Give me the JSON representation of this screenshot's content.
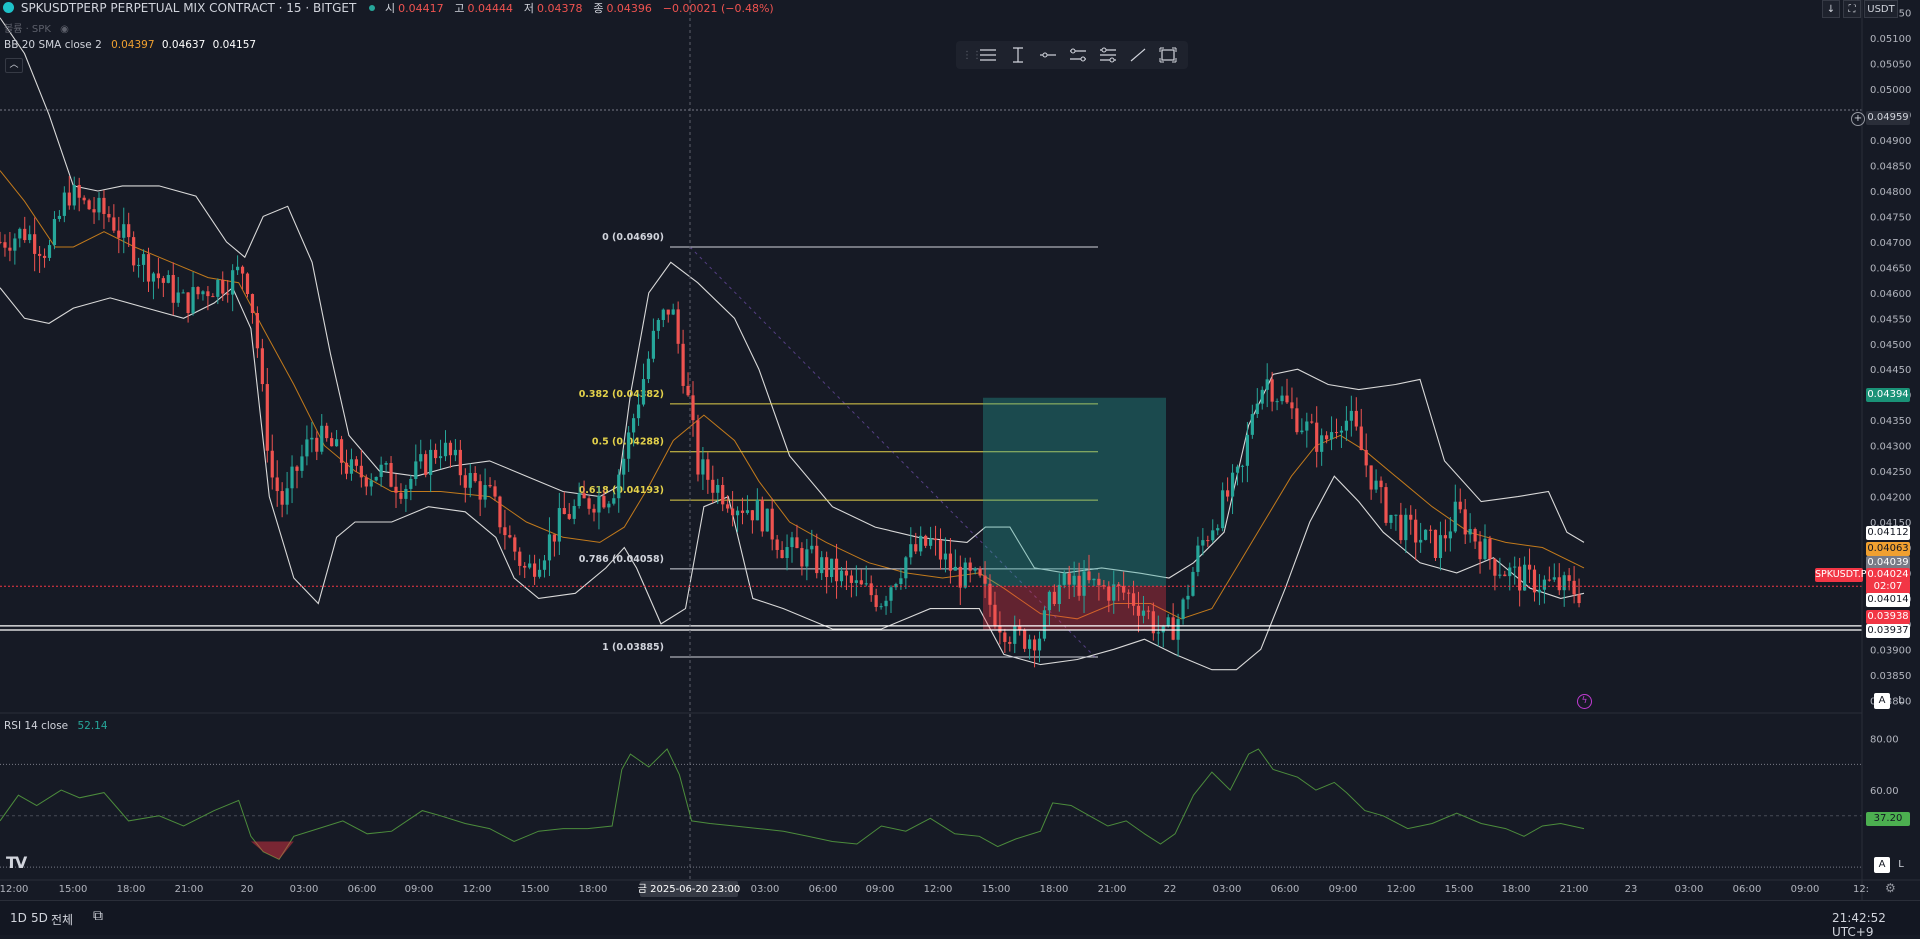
{
  "header": {
    "symbol": "SPKUSDTPERP PERPETUAL MIX CONTRACT · 15 · BITGET",
    "o_label": "시",
    "o_val": "0.04417",
    "h_label": "고",
    "h_val": "0.04444",
    "l_label": "저",
    "l_val": "0.04378",
    "c_label": "종",
    "c_val": "0.04396",
    "change": "−0.00021 (−0.48%)",
    "sub_label": "볼륨 · SPK"
  },
  "indicators": {
    "bb_label": "BB 20 SMA close 2",
    "bb_basis": "0.04397",
    "bb_upper": "0.04637",
    "bb_lower": "0.04157",
    "rsi_label": "RSI 14 close",
    "rsi_value": "52.14"
  },
  "top_right": {
    "currency": "USDT",
    "download_icon": "download-icon",
    "fullscreen_icon": "fullscreen-icon"
  },
  "drawing_toolbar": {
    "icons": [
      "horizontal-lines-icon",
      "vertical-line-icon",
      "horizontal-ray-icon",
      "parallel-lines-icon",
      "fib-lines-icon",
      "trend-line-icon",
      "rectangle-icon"
    ]
  },
  "price_axis": {
    "ticks": [
      "0.05150",
      "0.05100",
      "0.05050",
      "0.05000",
      "0.04950",
      "0.04900",
      "0.04850",
      "0.04800",
      "0.04750",
      "0.04700",
      "0.04650",
      "0.04600",
      "0.04550",
      "0.04500",
      "0.04450",
      "0.04400",
      "0.04350",
      "0.04300",
      "0.04250",
      "0.04200",
      "0.04150",
      "0.04100",
      "0.04050",
      "0.04000",
      "0.03950",
      "0.03900",
      "0.03850",
      "0.03800"
    ],
    "labels": {
      "alert": "0.04959",
      "green": "0.04394",
      "white1": "0.04112",
      "orange": "0.04063",
      "gray": "0.04039",
      "current": "0.04024",
      "countdown": "02:07",
      "white2": "0.04014",
      "red": "0.03938",
      "white3": "0.03937",
      "symbol_tag": "SPKUSDT.P"
    }
  },
  "rsi_axis": {
    "ticks": [
      "80.00",
      "60.00"
    ],
    "current": "37.20"
  },
  "fib_levels": [
    {
      "ratio_label": "0 (0.04690)",
      "price": 0.0469,
      "color": "#d1d4dc"
    },
    {
      "ratio_label": "0.382 (0.04382)",
      "price": 0.04382,
      "color": "#e3d14a"
    },
    {
      "ratio_label": "0.5 (0.04288)",
      "price": 0.04288,
      "color": "#e3d14a"
    },
    {
      "ratio_label": "0.618 (0.04193)",
      "price": 0.04193,
      "color": "#e3d14a"
    },
    {
      "ratio_label": "0.786 (0.04058)",
      "price": 0.04058,
      "color": "#d1d4dc"
    },
    {
      "ratio_label": "1 (0.03885)",
      "price": 0.03885,
      "color": "#d1d4dc"
    }
  ],
  "time_axis": {
    "ticks": [
      "12:00",
      "15:00",
      "18:00",
      "21:00",
      "20",
      "03:00",
      "06:00",
      "09:00",
      "12:00",
      "15:00",
      "18:00",
      "2025-06-20  23:00",
      "03:00",
      "06:00",
      "09:00",
      "12:00",
      "15:00",
      "18:00",
      "21:00",
      "22",
      "03:00",
      "06:00",
      "09:00",
      "12:00",
      "15:00",
      "18:00",
      "21:00",
      "23",
      "03:00",
      "06:00",
      "09:00",
      "12:"
    ],
    "crosshair_label": "금 2025-06-20  23:00"
  },
  "bottom_bar": {
    "range_1d": "1D",
    "range_5d": "5D",
    "range_all": "전체",
    "calendar_icon": "calendar-range-icon",
    "clock": "21:42:52 UTC+9"
  },
  "buttons": {
    "auto": "A",
    "log": "L"
  },
  "colors": {
    "bg": "#161a25",
    "up": "#26a69a",
    "down": "#ef5350",
    "bb": "#d9d9d9",
    "basis": "#c27a1c",
    "rsi": "#4c8c3c",
    "fib_gold": "#e3d14a"
  },
  "chart_data": {
    "type": "candlestick",
    "title": "SPKUSDTPERP PERPETUAL MIX CONTRACT · 15 · BITGET",
    "ylim": [
      0.03775,
      0.05175
    ],
    "y_ticks": [
      0.0515,
      0.051,
      0.0505,
      0.05,
      0.0495,
      0.049,
      0.0485,
      0.048,
      0.0475,
      0.047,
      0.0465,
      0.046,
      0.0455,
      0.045,
      0.0445,
      0.044,
      0.0435,
      0.043,
      0.0425,
      0.042,
      0.0415,
      0.041,
      0.0405,
      0.04,
      0.0395,
      0.039,
      0.0385,
      0.038
    ],
    "close_path": [
      [
        0,
        0.047
      ],
      [
        20,
        0.0472
      ],
      [
        40,
        0.0468
      ],
      [
        55,
        0.048
      ],
      [
        70,
        0.0477
      ],
      [
        90,
        0.0475
      ],
      [
        100,
        0.0471
      ],
      [
        110,
        0.0468
      ],
      [
        130,
        0.0463
      ],
      [
        150,
        0.0458
      ],
      [
        170,
        0.0461
      ],
      [
        190,
        0.0463
      ],
      [
        200,
        0.0465
      ],
      [
        208,
        0.0455
      ],
      [
        215,
        0.0438
      ],
      [
        222,
        0.0424
      ],
      [
        232,
        0.0418
      ],
      [
        240,
        0.0424
      ],
      [
        255,
        0.0432
      ],
      [
        270,
        0.043
      ],
      [
        290,
        0.0424
      ],
      [
        310,
        0.0425
      ],
      [
        330,
        0.0422
      ],
      [
        345,
        0.0426
      ],
      [
        360,
        0.043
      ],
      [
        380,
        0.0424
      ],
      [
        400,
        0.042
      ],
      [
        415,
        0.0412
      ],
      [
        430,
        0.0405
      ],
      [
        445,
        0.041
      ],
      [
        460,
        0.0416
      ],
      [
        480,
        0.0419
      ],
      [
        500,
        0.0421
      ],
      [
        510,
        0.0428
      ],
      [
        520,
        0.0438
      ],
      [
        535,
        0.0452
      ],
      [
        548,
        0.0458
      ],
      [
        560,
        0.0442
      ],
      [
        570,
        0.0426
      ],
      [
        585,
        0.0422
      ],
      [
        600,
        0.0419
      ],
      [
        620,
        0.0417
      ],
      [
        640,
        0.041
      ],
      [
        660,
        0.0408
      ],
      [
        680,
        0.0405
      ],
      [
        700,
        0.0402
      ],
      [
        720,
        0.04
      ],
      [
        740,
        0.0408
      ],
      [
        760,
        0.0411
      ],
      [
        780,
        0.0405
      ],
      [
        800,
        0.0403
      ],
      [
        815,
        0.0396
      ],
      [
        830,
        0.0392
      ],
      [
        850,
        0.0393
      ],
      [
        862,
        0.0402
      ],
      [
        880,
        0.0403
      ],
      [
        900,
        0.0402
      ],
      [
        920,
        0.0401
      ],
      [
        935,
        0.0398
      ],
      [
        950,
        0.0392
      ],
      [
        965,
        0.0397
      ],
      [
        980,
        0.041
      ],
      [
        1000,
        0.0419
      ],
      [
        1015,
        0.0425
      ],
      [
        1025,
        0.044
      ],
      [
        1035,
        0.0443
      ],
      [
        1050,
        0.0438
      ],
      [
        1065,
        0.0434
      ],
      [
        1080,
        0.043
      ],
      [
        1095,
        0.0436
      ],
      [
        1105,
        0.0434
      ],
      [
        1115,
        0.0427
      ],
      [
        1130,
        0.0418
      ],
      [
        1145,
        0.0414
      ],
      [
        1160,
        0.0412
      ],
      [
        1175,
        0.041
      ],
      [
        1190,
        0.0417
      ],
      [
        1205,
        0.0412
      ],
      [
        1220,
        0.0407
      ],
      [
        1240,
        0.0404
      ],
      [
        1260,
        0.0403
      ],
      [
        1280,
        0.0402
      ],
      [
        1294,
        0.0401
      ]
    ],
    "bb_upper_path": [
      [
        0,
        0.0514
      ],
      [
        20,
        0.0507
      ],
      [
        40,
        0.0495
      ],
      [
        60,
        0.0481
      ],
      [
        80,
        0.048
      ],
      [
        100,
        0.0481
      ],
      [
        130,
        0.0481
      ],
      [
        160,
        0.0479
      ],
      [
        185,
        0.047
      ],
      [
        200,
        0.0467
      ],
      [
        215,
        0.0475
      ],
      [
        235,
        0.0477
      ],
      [
        255,
        0.0466
      ],
      [
        270,
        0.0448
      ],
      [
        285,
        0.0432
      ],
      [
        310,
        0.0425
      ],
      [
        340,
        0.0424
      ],
      [
        370,
        0.0426
      ],
      [
        400,
        0.0427
      ],
      [
        430,
        0.0424
      ],
      [
        460,
        0.0421
      ],
      [
        490,
        0.042
      ],
      [
        505,
        0.0422
      ],
      [
        515,
        0.044
      ],
      [
        530,
        0.046
      ],
      [
        548,
        0.0466
      ],
      [
        570,
        0.0462
      ],
      [
        600,
        0.0455
      ],
      [
        620,
        0.0445
      ],
      [
        645,
        0.0428
      ],
      [
        680,
        0.0418
      ],
      [
        715,
        0.0414
      ],
      [
        750,
        0.0412
      ],
      [
        790,
        0.0411
      ],
      [
        805,
        0.0414
      ],
      [
        825,
        0.0414
      ],
      [
        845,
        0.0406
      ],
      [
        870,
        0.0405
      ],
      [
        900,
        0.0406
      ],
      [
        930,
        0.0405
      ],
      [
        955,
        0.0404
      ],
      [
        975,
        0.0407
      ],
      [
        1000,
        0.0413
      ],
      [
        1020,
        0.0434
      ],
      [
        1040,
        0.0444
      ],
      [
        1060,
        0.0445
      ],
      [
        1085,
        0.0442
      ],
      [
        1110,
        0.0441
      ],
      [
        1140,
        0.0442
      ],
      [
        1160,
        0.0443
      ],
      [
        1180,
        0.0427
      ],
      [
        1210,
        0.0419
      ],
      [
        1240,
        0.042
      ],
      [
        1265,
        0.0421
      ],
      [
        1280,
        0.0413
      ],
      [
        1294,
        0.0411
      ]
    ],
    "bb_lower_path": [
      [
        0,
        0.0461
      ],
      [
        20,
        0.0455
      ],
      [
        40,
        0.0454
      ],
      [
        60,
        0.0457
      ],
      [
        90,
        0.0459
      ],
      [
        120,
        0.0457
      ],
      [
        150,
        0.0455
      ],
      [
        175,
        0.0458
      ],
      [
        190,
        0.0461
      ],
      [
        205,
        0.0453
      ],
      [
        220,
        0.042
      ],
      [
        240,
        0.0404
      ],
      [
        260,
        0.0399
      ],
      [
        275,
        0.0412
      ],
      [
        290,
        0.0415
      ],
      [
        320,
        0.0415
      ],
      [
        350,
        0.0418
      ],
      [
        380,
        0.0417
      ],
      [
        405,
        0.0412
      ],
      [
        420,
        0.0404
      ],
      [
        440,
        0.04
      ],
      [
        470,
        0.0401
      ],
      [
        495,
        0.0406
      ],
      [
        510,
        0.041
      ],
      [
        520,
        0.0406
      ],
      [
        540,
        0.0395
      ],
      [
        560,
        0.0398
      ],
      [
        575,
        0.0418
      ],
      [
        595,
        0.042
      ],
      [
        615,
        0.04
      ],
      [
        640,
        0.0398
      ],
      [
        680,
        0.0394
      ],
      [
        720,
        0.0394
      ],
      [
        760,
        0.0398
      ],
      [
        800,
        0.0398
      ],
      [
        820,
        0.0389
      ],
      [
        850,
        0.0387
      ],
      [
        880,
        0.0388
      ],
      [
        910,
        0.039
      ],
      [
        935,
        0.0392
      ],
      [
        960,
        0.0389
      ],
      [
        990,
        0.0386
      ],
      [
        1010,
        0.0386
      ],
      [
        1030,
        0.039
      ],
      [
        1050,
        0.0402
      ],
      [
        1070,
        0.0415
      ],
      [
        1090,
        0.0424
      ],
      [
        1110,
        0.0419
      ],
      [
        1130,
        0.0413
      ],
      [
        1160,
        0.0407
      ],
      [
        1190,
        0.0405
      ],
      [
        1220,
        0.0408
      ],
      [
        1250,
        0.0402
      ],
      [
        1275,
        0.04
      ],
      [
        1294,
        0.0401
      ]
    ],
    "bb_basis_path": [
      [
        0,
        0.0484
      ],
      [
        20,
        0.0478
      ],
      [
        45,
        0.0469
      ],
      [
        60,
        0.0469
      ],
      [
        85,
        0.0472
      ],
      [
        110,
        0.0469
      ],
      [
        140,
        0.0466
      ],
      [
        170,
        0.0463
      ],
      [
        195,
        0.0462
      ],
      [
        215,
        0.0453
      ],
      [
        240,
        0.0442
      ],
      [
        265,
        0.043
      ],
      [
        290,
        0.0425
      ],
      [
        320,
        0.0421
      ],
      [
        360,
        0.0421
      ],
      [
        400,
        0.042
      ],
      [
        430,
        0.0415
      ],
      [
        460,
        0.0412
      ],
      [
        490,
        0.0411
      ],
      [
        510,
        0.0414
      ],
      [
        530,
        0.0422
      ],
      [
        550,
        0.0431
      ],
      [
        575,
        0.0436
      ],
      [
        600,
        0.0431
      ],
      [
        620,
        0.0423
      ],
      [
        645,
        0.0415
      ],
      [
        675,
        0.0411
      ],
      [
        710,
        0.0407
      ],
      [
        740,
        0.0405
      ],
      [
        770,
        0.0404
      ],
      [
        800,
        0.0405
      ],
      [
        820,
        0.0402
      ],
      [
        850,
        0.0397
      ],
      [
        880,
        0.0396
      ],
      [
        910,
        0.0399
      ],
      [
        940,
        0.0399
      ],
      [
        965,
        0.0396
      ],
      [
        990,
        0.0398
      ],
      [
        1010,
        0.0406
      ],
      [
        1035,
        0.0416
      ],
      [
        1055,
        0.0424
      ],
      [
        1075,
        0.043
      ],
      [
        1095,
        0.0432
      ],
      [
        1115,
        0.0429
      ],
      [
        1140,
        0.0424
      ],
      [
        1170,
        0.0418
      ],
      [
        1200,
        0.0413
      ],
      [
        1230,
        0.0411
      ],
      [
        1260,
        0.041
      ],
      [
        1294,
        0.0406
      ]
    ],
    "rsi_ylim": [
      25,
      90
    ],
    "rsi_path": [
      [
        0,
        48
      ],
      [
        15,
        58
      ],
      [
        30,
        54
      ],
      [
        50,
        60
      ],
      [
        65,
        57
      ],
      [
        85,
        59
      ],
      [
        105,
        48
      ],
      [
        130,
        50
      ],
      [
        150,
        46
      ],
      [
        175,
        52
      ],
      [
        195,
        56
      ],
      [
        205,
        42
      ],
      [
        215,
        36
      ],
      [
        228,
        33
      ],
      [
        240,
        42
      ],
      [
        260,
        45
      ],
      [
        280,
        48
      ],
      [
        300,
        43
      ],
      [
        320,
        44
      ],
      [
        345,
        52
      ],
      [
        360,
        50
      ],
      [
        380,
        47
      ],
      [
        400,
        45
      ],
      [
        420,
        40
      ],
      [
        440,
        44
      ],
      [
        460,
        45
      ],
      [
        480,
        45
      ],
      [
        500,
        46
      ],
      [
        508,
        68
      ],
      [
        515,
        74
      ],
      [
        530,
        69
      ],
      [
        545,
        76
      ],
      [
        555,
        66
      ],
      [
        565,
        48
      ],
      [
        580,
        47
      ],
      [
        600,
        46
      ],
      [
        620,
        45
      ],
      [
        640,
        44
      ],
      [
        660,
        42
      ],
      [
        680,
        40
      ],
      [
        700,
        39
      ],
      [
        720,
        46
      ],
      [
        740,
        44
      ],
      [
        760,
        49
      ],
      [
        780,
        43
      ],
      [
        800,
        42
      ],
      [
        815,
        38
      ],
      [
        830,
        41
      ],
      [
        850,
        44
      ],
      [
        860,
        55
      ],
      [
        875,
        54
      ],
      [
        890,
        50
      ],
      [
        905,
        46
      ],
      [
        920,
        48
      ],
      [
        935,
        43
      ],
      [
        948,
        39
      ],
      [
        960,
        43
      ],
      [
        975,
        58
      ],
      [
        990,
        67
      ],
      [
        1005,
        60
      ],
      [
        1020,
        74
      ],
      [
        1028,
        76
      ],
      [
        1040,
        68
      ],
      [
        1060,
        65
      ],
      [
        1075,
        60
      ],
      [
        1090,
        63
      ],
      [
        1100,
        59
      ],
      [
        1115,
        52
      ],
      [
        1130,
        50
      ],
      [
        1150,
        45
      ],
      [
        1170,
        47
      ],
      [
        1190,
        51
      ],
      [
        1210,
        47
      ],
      [
        1230,
        45
      ],
      [
        1245,
        42
      ],
      [
        1260,
        46
      ],
      [
        1275,
        47
      ],
      [
        1294,
        45
      ]
    ]
  }
}
